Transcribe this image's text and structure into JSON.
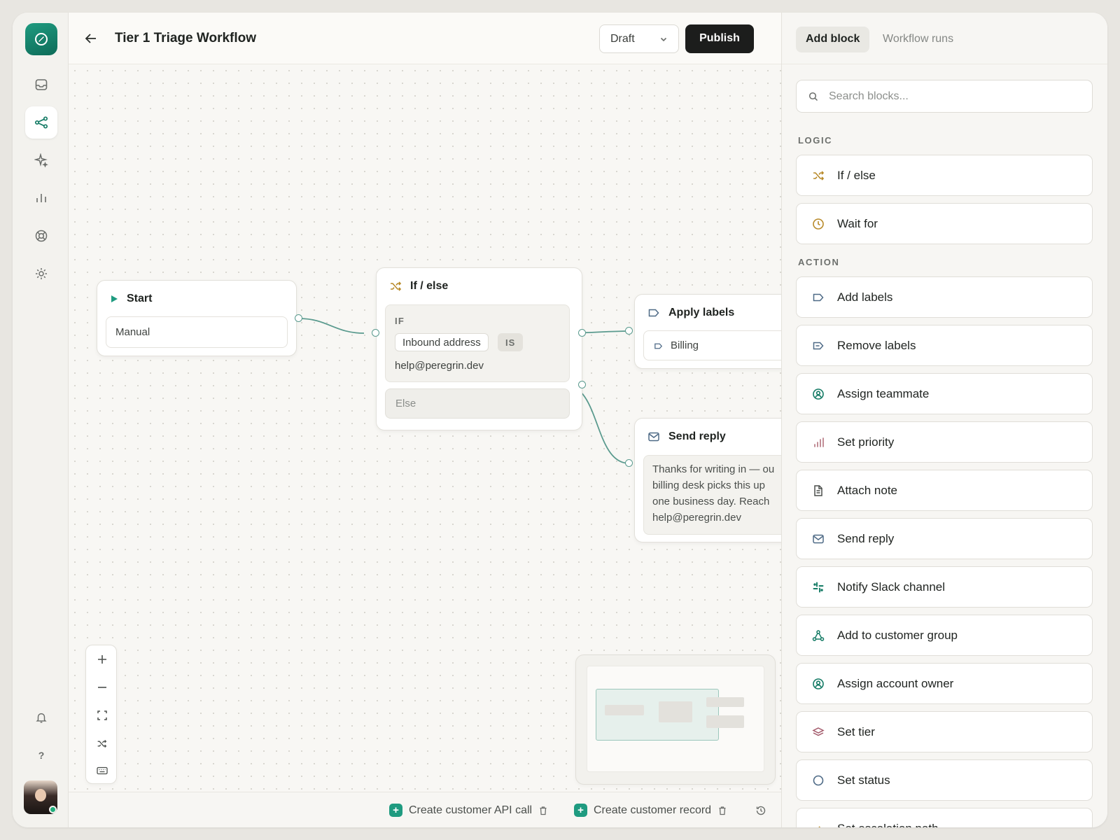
{
  "header": {
    "title": "Tier 1 Triage Workflow",
    "status_select": "Draft",
    "publish_label": "Publish"
  },
  "canvas": {
    "start_node": {
      "title": "Start",
      "trigger": "Manual"
    },
    "ifelse_node": {
      "title": "If / else",
      "if_label": "IF",
      "field": "Inbound address",
      "operator": "IS",
      "value": "help@peregrin.dev",
      "else_label": "Else"
    },
    "labels_node": {
      "title": "Apply labels",
      "label": "Billing"
    },
    "reply_node": {
      "title": "Send reply",
      "lines": [
        "Thanks for writing in — ou",
        "billing desk picks this up",
        "one business day. Reach",
        "help@peregrin.dev"
      ]
    }
  },
  "footer": {
    "items": [
      {
        "label": "Create customer API call"
      },
      {
        "label": "Create customer record"
      }
    ]
  },
  "panel": {
    "tabs": {
      "active": "Add block",
      "other": "Workflow runs"
    },
    "search_placeholder": "Search blocks...",
    "sections": {
      "logic": "LOGIC",
      "action": "ACTION"
    },
    "logic_blocks": [
      {
        "label": "If / else",
        "icon": "shuffle-icon"
      },
      {
        "label": "Wait for",
        "icon": "clock-icon"
      }
    ],
    "action_blocks": [
      {
        "label": "Add labels",
        "icon": "tag-icon"
      },
      {
        "label": "Remove labels",
        "icon": "tag-minus-icon"
      },
      {
        "label": "Assign teammate",
        "icon": "user-circle-icon"
      },
      {
        "label": "Set priority",
        "icon": "bars-icon"
      },
      {
        "label": "Attach note",
        "icon": "note-icon"
      },
      {
        "label": "Send reply",
        "icon": "mail-icon"
      },
      {
        "label": "Notify Slack channel",
        "icon": "slack-icon"
      },
      {
        "label": "Add to customer group",
        "icon": "group-icon"
      },
      {
        "label": "Assign account owner",
        "icon": "user-circle-icon"
      },
      {
        "label": "Set tier",
        "icon": "layers-icon"
      },
      {
        "label": "Set status",
        "icon": "circle-icon"
      },
      {
        "label": "Set escalation path",
        "icon": "escalate-icon"
      }
    ]
  },
  "colors": {
    "accent": "#1f9b80",
    "publish_bg": "#1c1d1c",
    "edge": "#5a9a8e",
    "amber": "#b88a2a"
  }
}
